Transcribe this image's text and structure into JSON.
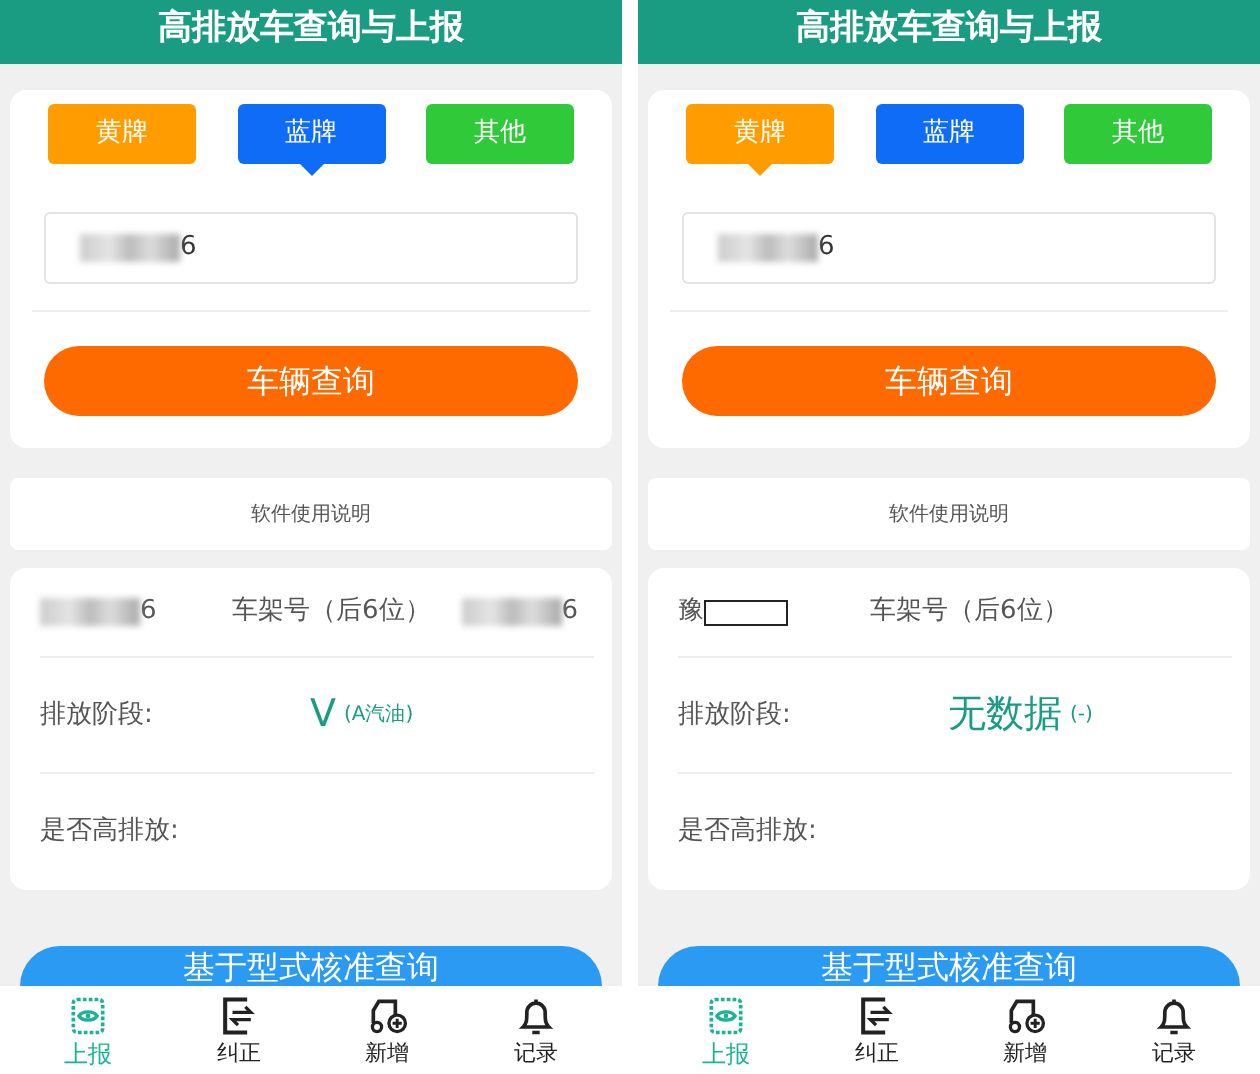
{
  "screens": [
    {
      "title": "高排放车查询与上报",
      "plate_tabs": [
        {
          "label": "黄牌",
          "color": "#ff9d00",
          "selected": false
        },
        {
          "label": "蓝牌",
          "color": "#0f6cf7",
          "selected": true
        },
        {
          "label": "其他",
          "color": "#2fc93a",
          "selected": false
        }
      ],
      "plate_input": {
        "kind": "blurred",
        "value": "6"
      },
      "query_button": "车辆查询",
      "instructions_link": "软件使用说明",
      "vehicle": {
        "plate": {
          "kind": "blurred",
          "text": "6"
        },
        "frame_label": "车架号（后6位）",
        "frame_value": "6"
      },
      "emission_stage": {
        "label": "排放阶段:",
        "value": "V",
        "note": "(A汽油)"
      },
      "high_emission": {
        "label": "是否高排放:"
      },
      "model_query_button": "基于型式核准查询",
      "nav": [
        {
          "label": "上报",
          "selected": true
        },
        {
          "label": "纠正",
          "selected": false
        },
        {
          "label": "新增",
          "selected": false
        },
        {
          "label": "记录",
          "selected": false
        }
      ]
    },
    {
      "title": "高排放车查询与上报",
      "plate_tabs": [
        {
          "label": "黄牌",
          "color": "#ff9d00",
          "selected": true
        },
        {
          "label": "蓝牌",
          "color": "#0f6cf7",
          "selected": false
        },
        {
          "label": "其他",
          "color": "#2fc93a",
          "selected": false
        }
      ],
      "plate_input": {
        "kind": "blurred",
        "value": "6"
      },
      "query_button": "车辆查询",
      "instructions_link": "软件使用说明",
      "vehicle": {
        "plate": {
          "kind": "boxed",
          "text": "豫"
        },
        "frame_label": "车架号（后6位）"
      },
      "emission_stage": {
        "label": "排放阶段:",
        "value": "无数据",
        "note": "(-)"
      },
      "high_emission": {
        "label": "是否高排放:"
      },
      "model_query_button": "基于型式核准查询",
      "nav": [
        {
          "label": "上报",
          "selected": true
        },
        {
          "label": "纠正",
          "selected": false
        },
        {
          "label": "新增",
          "selected": false
        },
        {
          "label": "记录",
          "selected": false
        }
      ]
    }
  ]
}
